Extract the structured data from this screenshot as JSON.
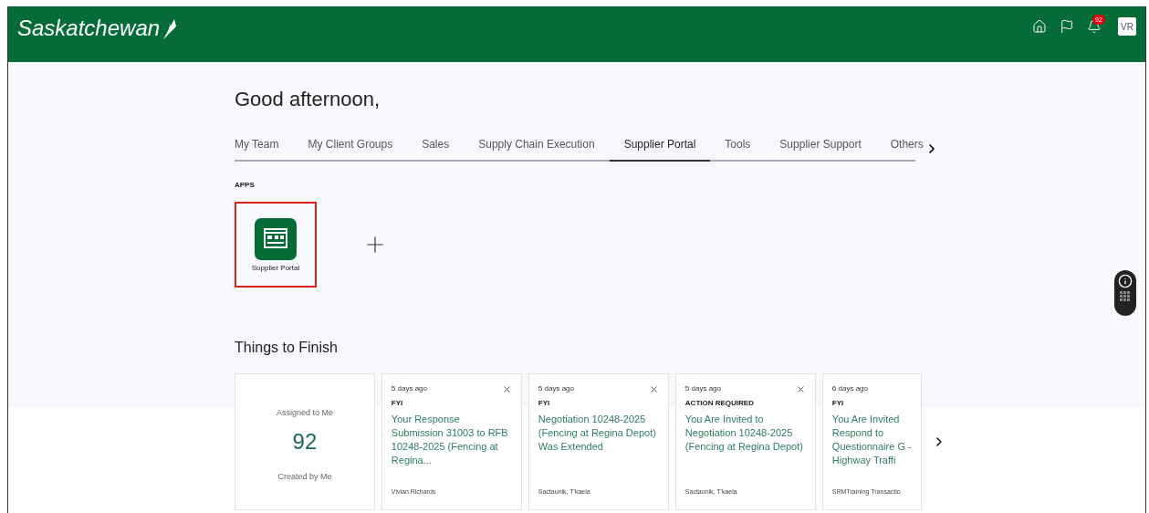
{
  "header": {
    "logo": "Saskatchewan",
    "notification_count": "92",
    "avatar": "VR"
  },
  "greeting": "Good afternoon,",
  "tabs": [
    {
      "label": "My Team",
      "selected": false
    },
    {
      "label": "My Client Groups",
      "selected": false
    },
    {
      "label": "Sales",
      "selected": false
    },
    {
      "label": "Supply Chain Execution",
      "selected": false
    },
    {
      "label": "Supplier Portal",
      "selected": true
    },
    {
      "label": "Tools",
      "selected": false
    },
    {
      "label": "Supplier Support",
      "selected": false
    },
    {
      "label": "Others",
      "selected": false
    }
  ],
  "apps": {
    "heading": "APPS",
    "items": [
      {
        "label": "Supplier Portal",
        "highlighted": true
      }
    ]
  },
  "things_to_finish": {
    "title": "Things to Finish",
    "summary": {
      "assigned_label": "Assigned to Me",
      "assigned_count": "92",
      "created_label": "Created by Me"
    },
    "cards": [
      {
        "time": "5 days ago",
        "category": "FYI",
        "title": "Your Response Submission 31003 to RFB 10248-2025 (Fencing at Regina...",
        "person": "Vivian Richards",
        "closable": true
      },
      {
        "time": "5 days ago",
        "category": "FYI",
        "title": "Negotiation 10248-2025 (Fencing at Regina Depot) Was Extended",
        "person": "Sactaunik, T'kaela",
        "closable": true
      },
      {
        "time": "5 days ago",
        "category": "ACTION REQUIRED",
        "title": "You Are Invited to Negotiation 10248-2025 (Fencing at Regina Depot)",
        "person": "Sactaunik, T'kaela",
        "closable": true
      },
      {
        "time": "6 days ago",
        "category": "FYI",
        "title": "You Are Invited Respond to Questionnaire G - Highway Traffi",
        "person": "SRMTraining Transactio",
        "closable": false
      }
    ]
  }
}
